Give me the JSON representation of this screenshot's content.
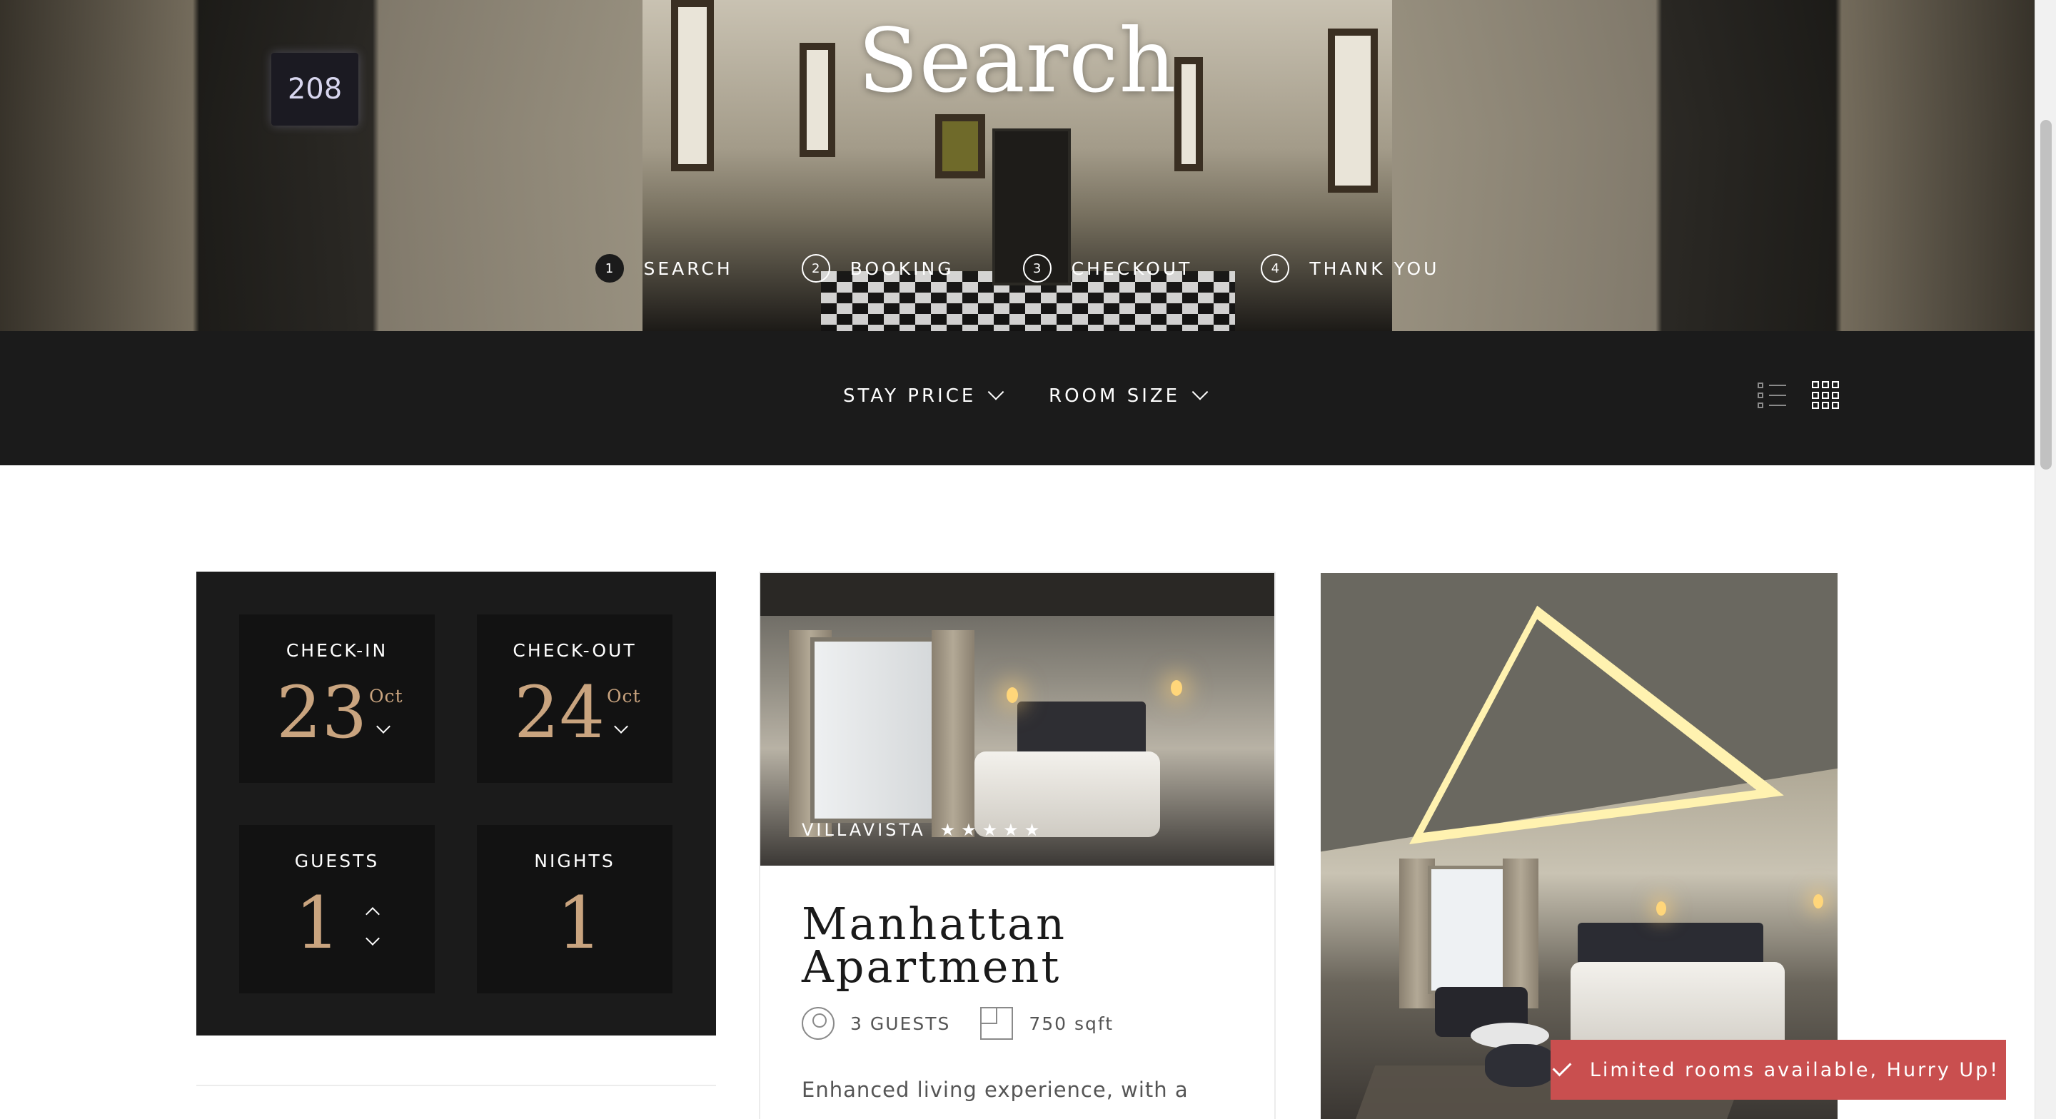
{
  "hero": {
    "title": "Search",
    "room_sign": "208",
    "steps": [
      {
        "num": "1",
        "label": "SEARCH",
        "active": true
      },
      {
        "num": "2",
        "label": "BOOKING",
        "active": false
      },
      {
        "num": "3",
        "label": "CHECKOUT",
        "active": false
      },
      {
        "num": "4",
        "label": "THANK YOU",
        "active": false
      }
    ]
  },
  "filters": {
    "stay_price": "STAY PRICE",
    "room_size": "ROOM SIZE",
    "view_icons": [
      "list-view-icon",
      "grid-view-icon"
    ],
    "active_view": "grid"
  },
  "booking": {
    "checkin": {
      "label": "CHECK-IN",
      "day": "23",
      "month": "Oct"
    },
    "checkout": {
      "label": "CHECK-OUT",
      "day": "24",
      "month": "Oct"
    },
    "guests": {
      "label": "GUESTS",
      "value": "1"
    },
    "nights": {
      "label": "NIGHTS",
      "value": "1"
    }
  },
  "room_card": {
    "brand": "VILLAVISTA",
    "stars": "★★★★★",
    "rating": 5,
    "title": "Manhattan Apartment",
    "guests": "3 GUESTS",
    "size": "750 sqft",
    "description": "Enhanced living experience, with a"
  },
  "toast": {
    "message": "Limited rooms available, Hurry Up!"
  },
  "colors": {
    "dark_bar": "#1b1b1b",
    "accent_gold": "#c9a47f",
    "toast_red": "#c94f4f"
  }
}
